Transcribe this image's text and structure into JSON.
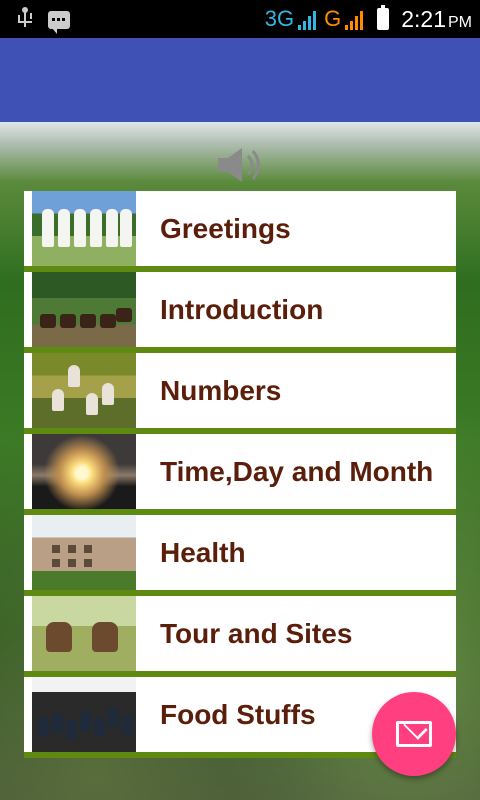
{
  "status_bar": {
    "net1": "3G",
    "net2": "G",
    "time": "2:21",
    "ampm": "PM"
  },
  "icons": {
    "usb": "usb-icon",
    "message": "message-icon",
    "speaker": "speaker-icon",
    "mail": "mail-icon"
  },
  "colors": {
    "app_bar": "#3f51b5",
    "fab": "#ff3f80",
    "item_divider": "#5f8a12",
    "item_text": "#5a1e0a"
  },
  "menu": {
    "items": [
      {
        "label": "Greetings"
      },
      {
        "label": "Introduction"
      },
      {
        "label": "Numbers"
      },
      {
        "label": "Time,Day and Month"
      },
      {
        "label": "Health"
      },
      {
        "label": "Tour and Sites"
      },
      {
        "label": "Food Stuffs"
      }
    ]
  }
}
